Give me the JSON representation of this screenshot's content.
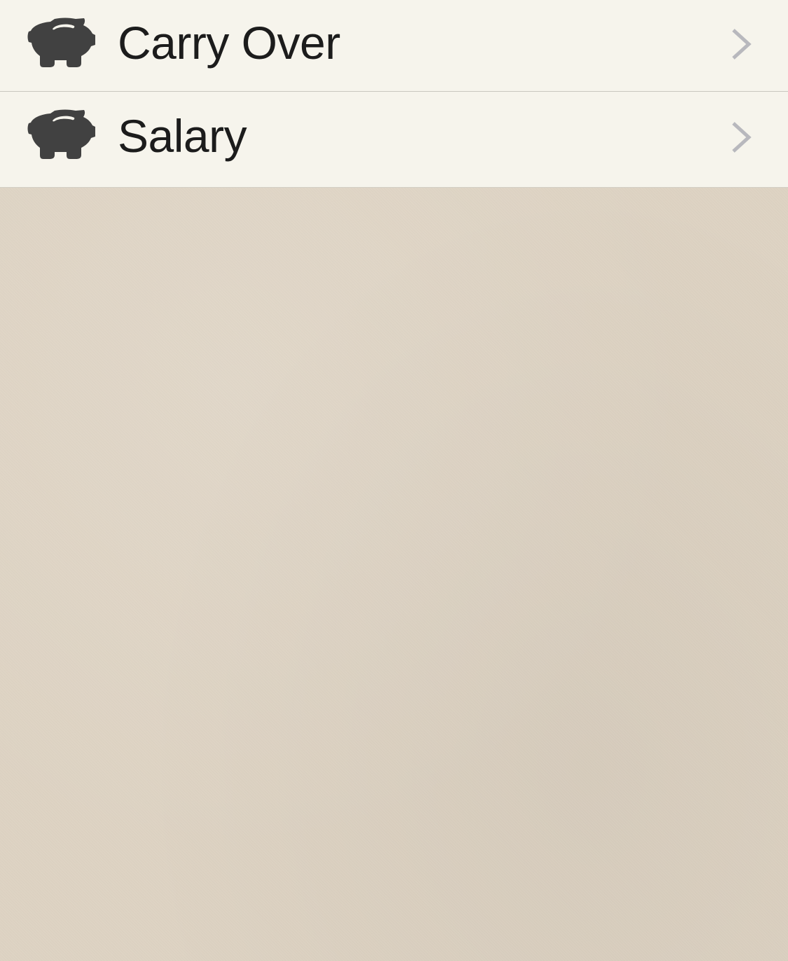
{
  "list": {
    "items": [
      {
        "label": "Carry Over",
        "icon": "piggy-bank-icon"
      },
      {
        "label": "Salary",
        "icon": "piggy-bank-icon"
      }
    ]
  },
  "colors": {
    "row_background": "#f6f4ec",
    "page_background": "#ded3c3",
    "icon": "#414141",
    "chevron": "#b8b8bd",
    "text": "#1c1c1c"
  }
}
